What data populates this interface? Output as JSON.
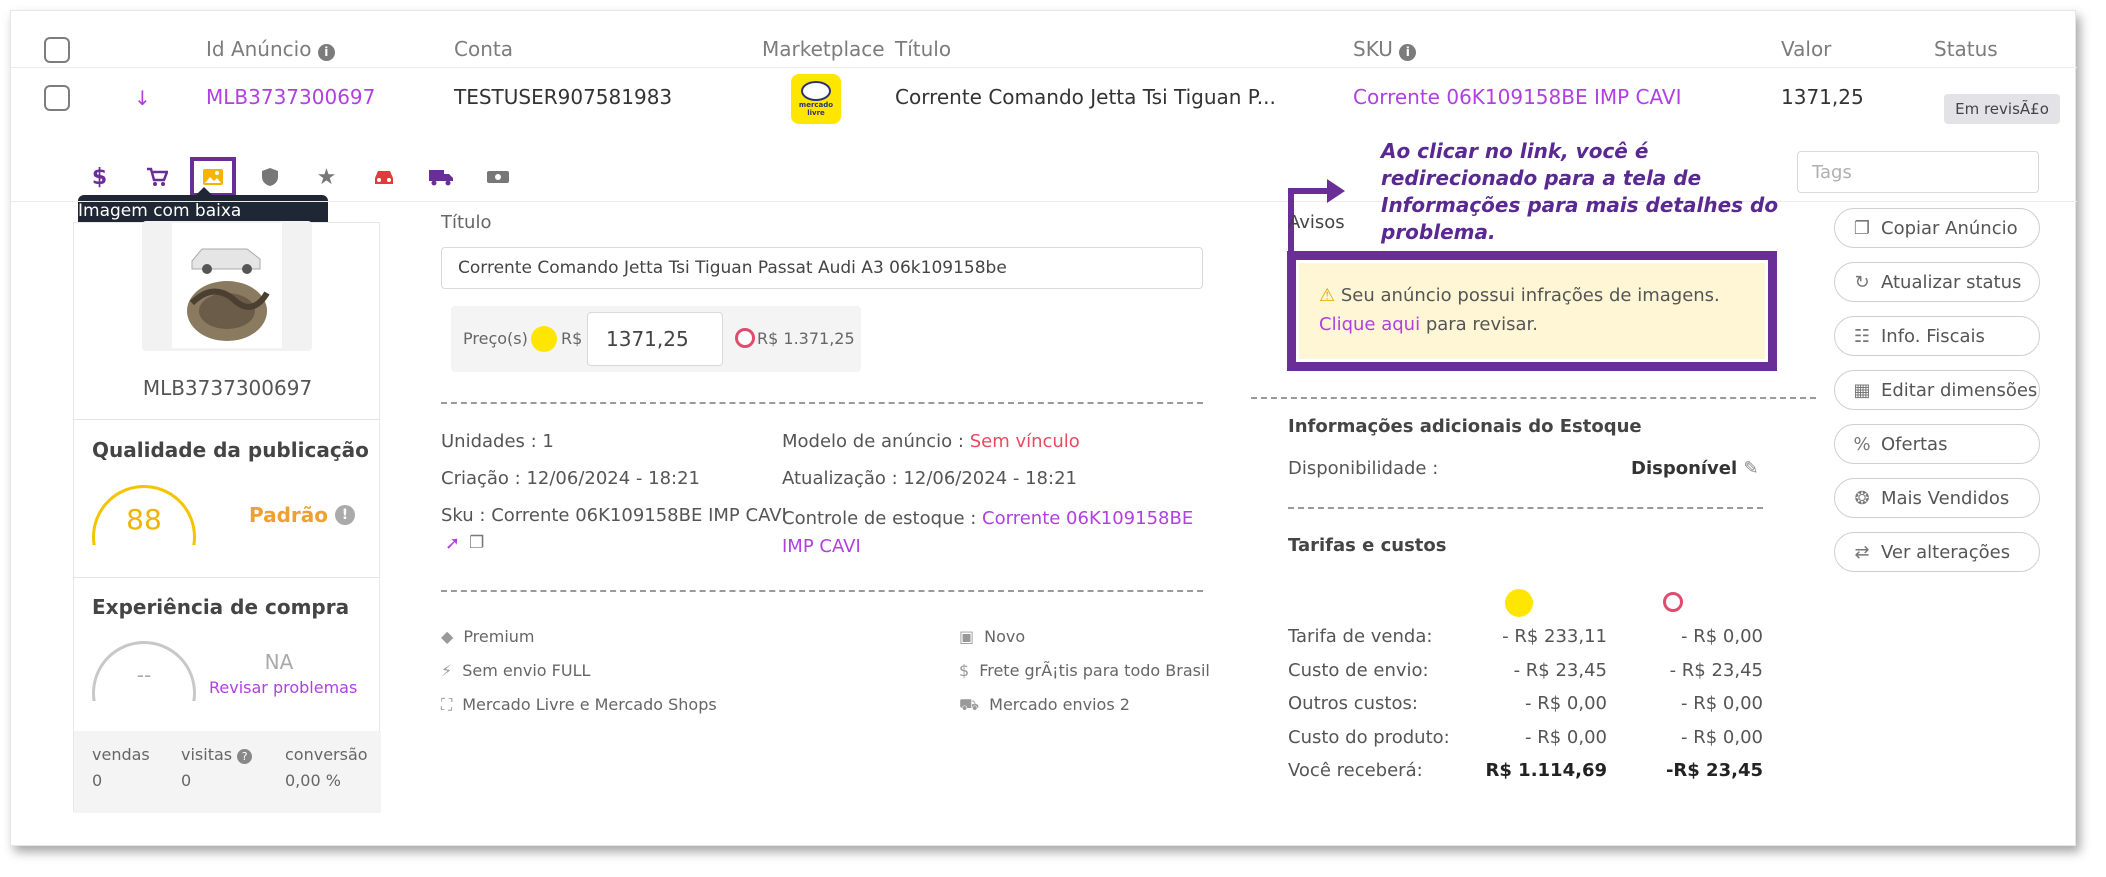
{
  "header": {
    "id_anuncio": "Id Anúncio",
    "conta": "Conta",
    "marketplace": "Marketplace",
    "titulo": "Título",
    "sku": "SKU",
    "valor": "Valor",
    "status": "Status"
  },
  "row": {
    "id": "MLB3737300697",
    "conta": "TESTUSER907581983",
    "titulo": "Corrente Comando Jetta Tsi Tiguan P...",
    "sku": "Corrente 06K109158BE IMP CAVI",
    "valor": "1371,25",
    "status": "Em revisÃ£o"
  },
  "marketplace_logo_text": "mercado livre",
  "tooltip": "Imagem com baixa qualidade",
  "tags_placeholder": "Tags",
  "annotation": "Ao clicar no link, você é redirecionado para a tela de Informações para mais detalhes do problema.",
  "left_card": {
    "id": "MLB3737300697",
    "quality_title": "Qualidade da publicação",
    "quality_score": "88",
    "quality_label": "Padrão",
    "experience_title": "Experiência de compra",
    "experience_score": "--",
    "experience_value": "NA",
    "experience_link": "Revisar problemas",
    "stats": [
      {
        "label": "vendas",
        "value": "0"
      },
      {
        "label": "visitas",
        "value": "0"
      },
      {
        "label": "conversão",
        "value": "0,00 %"
      }
    ]
  },
  "middle": {
    "titulo_label": "Título",
    "titulo_value": "Corrente Comando Jetta Tsi Tiguan Passat Audi A3 06k109158be",
    "precos_label": "Preço(s)",
    "currency": "R$",
    "price_value": "1371,25",
    "price_secondary": "R$ 1.371,25",
    "unidades": "Unidades : 1",
    "criacao": "Criação : 12/06/2024 - 18:21",
    "sku_line": "Sku : Corrente 06K109158BE IMP CAVI",
    "modelo_label": "Modelo de anúncio :",
    "modelo_value": "Sem vínculo",
    "atualizacao": "Atualização : 12/06/2024 - 18:21",
    "controle_label": "Controle de estoque :",
    "controle_value_1": "Corrente 06K109158BE",
    "controle_value_2": "IMP CAVI",
    "features_left": [
      "Premium",
      "Sem envio FULL",
      "Mercado Livre e Mercado Shops"
    ],
    "features_right": [
      "Novo",
      "Frete grÃ¡tis para todo Brasil",
      "Mercado envios 2"
    ]
  },
  "avisos": {
    "title": "Avisos",
    "message": "Seu anúncio possui infrações de imagens.",
    "link": "Clique aqui",
    "suffix": "para revisar."
  },
  "estoque": {
    "title": "Informações adicionais do Estoque",
    "disponibilidade_label": "Disponibilidade :",
    "disponibilidade_value": "Disponível"
  },
  "tarifas": {
    "title": "Tarifas e custos",
    "rows": [
      {
        "label": "Tarifa de venda:",
        "ml": "- R$ 233,11",
        "shops": "- R$ 0,00"
      },
      {
        "label": "Custo de envio:",
        "ml": "- R$ 23,45",
        "shops": "- R$ 23,45"
      },
      {
        "label": "Outros custos:",
        "ml": "- R$ 0,00",
        "shops": "- R$ 0,00"
      },
      {
        "label": "Custo do produto:",
        "ml": "- R$ 0,00",
        "shops": "- R$ 0,00"
      },
      {
        "label": "Você receberá:",
        "ml": "R$ 1.114,69",
        "shops": "-R$ 23,45"
      }
    ]
  },
  "actions": [
    "Copiar Anúncio",
    "Atualizar status",
    "Info. Fiscais",
    "Editar dimensões",
    "Ofertas",
    "Mais Vendidos",
    "Ver alterações"
  ],
  "colors": {
    "accent_purple": "#b040e0",
    "annotation_purple": "#6a2f97",
    "ml_yellow": "#ffe600",
    "quality_gauge": "#f5c400",
    "quality_label": "#f0a030",
    "sem_vinculo": "#e84a5f"
  }
}
